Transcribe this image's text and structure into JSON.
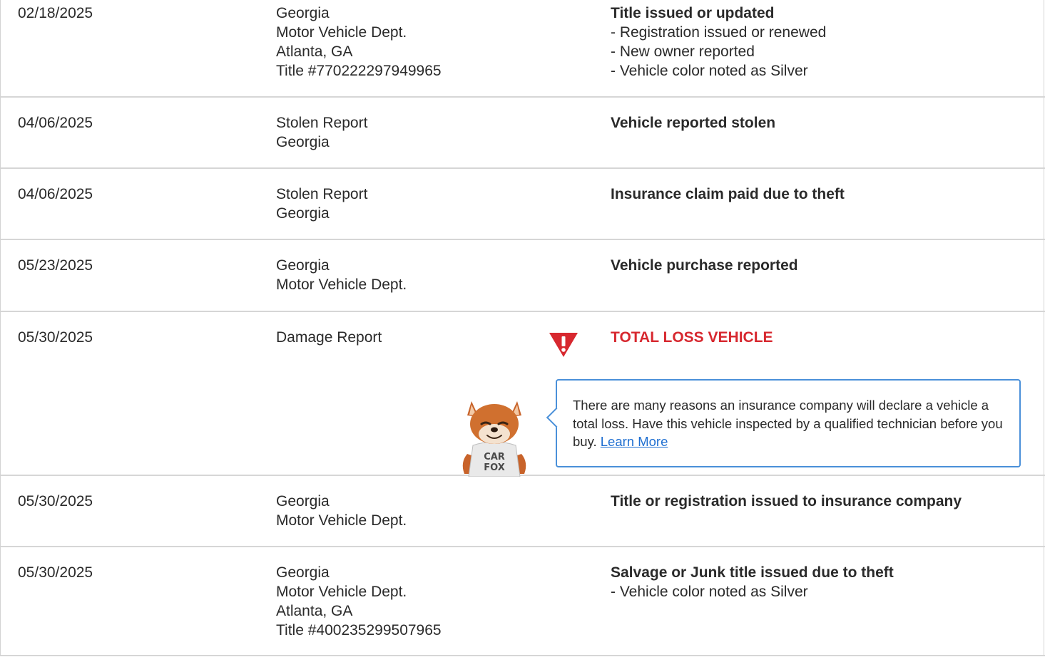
{
  "records": [
    {
      "date": "02/18/2025",
      "source": [
        "Georgia",
        "Motor Vehicle Dept.",
        "Atlanta, GA",
        "Title #770222297949965"
      ],
      "headline": "Title issued or updated",
      "details": [
        "Registration issued or renewed",
        "New owner reported",
        "Vehicle color noted as Silver"
      ]
    },
    {
      "date": "04/06/2025",
      "source": [
        "Stolen Report",
        "Georgia"
      ],
      "headline": "Vehicle reported stolen",
      "details": []
    },
    {
      "date": "04/06/2025",
      "source": [
        "Stolen Report",
        "Georgia"
      ],
      "headline": "Insurance claim paid due to theft",
      "details": []
    },
    {
      "date": "05/23/2025",
      "source": [
        "Georgia",
        "Motor Vehicle Dept."
      ],
      "headline": "Vehicle purchase reported",
      "details": []
    },
    {
      "date": "05/30/2025",
      "source": [
        "Damage Report"
      ],
      "headline": "TOTAL LOSS VEHICLE",
      "details": [],
      "alert": true,
      "callout": {
        "text": "There are many reasons an insurance company will declare a vehicle a total loss. Have this vehicle inspected by a qualified technician before you buy.",
        "link_label": "Learn More"
      }
    },
    {
      "date": "05/30/2025",
      "source": [
        "Georgia",
        "Motor Vehicle Dept."
      ],
      "headline": "Title or registration issued to insurance company",
      "details": []
    },
    {
      "date": "05/30/2025",
      "source": [
        "Georgia",
        "Motor Vehicle Dept.",
        "Atlanta, GA",
        "Title #400235299507965"
      ],
      "headline": "Salvage or Junk title issued due to theft",
      "details": [
        "Vehicle color noted as Silver"
      ]
    }
  ],
  "mascot": {
    "shirt_line_1": "CAR",
    "shirt_line_2": "FOX"
  },
  "colors": {
    "alert_red": "#d7282f",
    "callout_border": "#4a90d9",
    "link_blue": "#1f6fd1",
    "divider": "#d6d6d6",
    "text": "#2a2a2a"
  },
  "icons": {
    "alert": "warning-triangle-icon",
    "mascot": "carfox-mascot"
  }
}
